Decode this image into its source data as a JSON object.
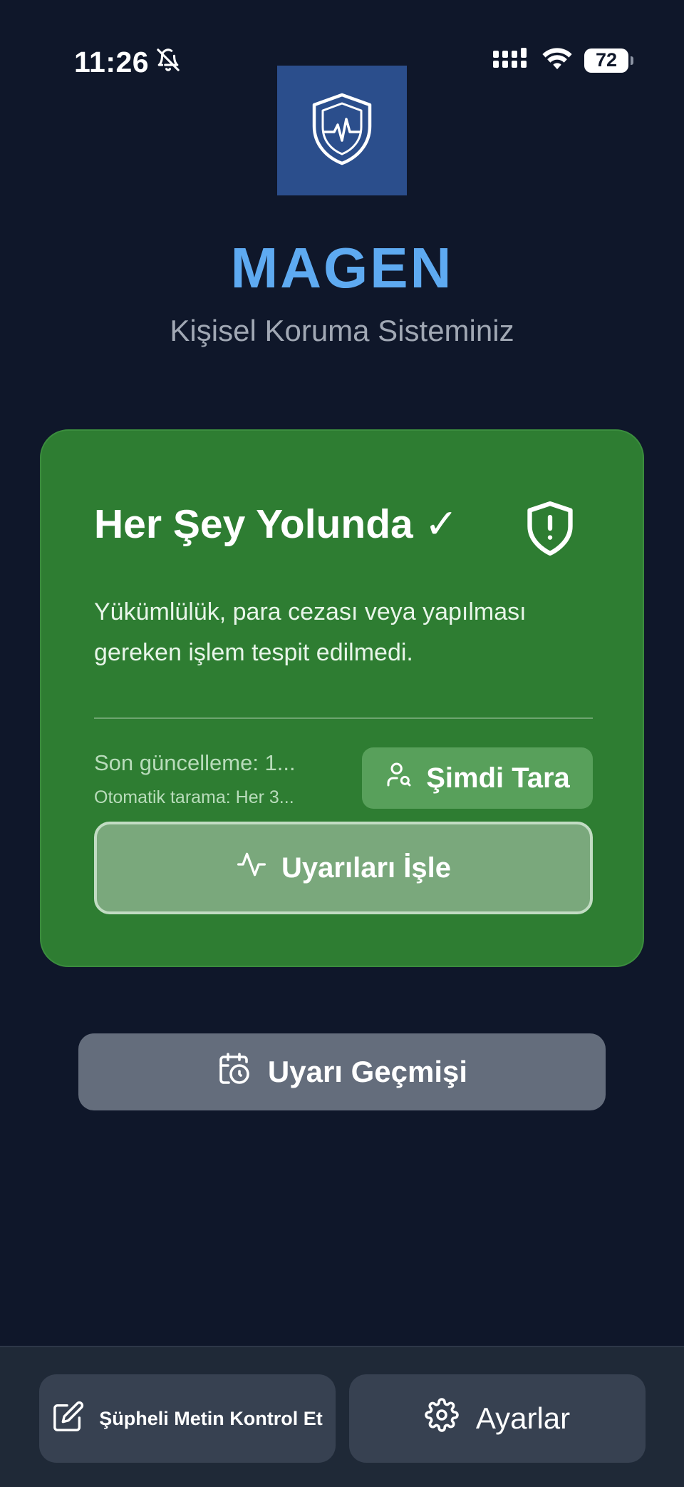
{
  "status_bar": {
    "time": "11:26",
    "battery": "72"
  },
  "app": {
    "title": "MAGEN",
    "subtitle": "Kişisel Koruma Sisteminiz",
    "logo_icon": "shield-heartbeat-icon"
  },
  "status_card": {
    "title": "Her Şey Yolunda ✓",
    "description": "Yükümlülük, para cezası veya yapılması gereken işlem tespit edilmedi.",
    "last_update": "Son güncelleme: 1...",
    "auto_scan": "Otomatik tarama: Her 3...",
    "scan_button": "Şimdi Tara",
    "process_button": "Uyarıları İşle",
    "background_color": "#2e7d32"
  },
  "history_button": "Uyarı Geçmişi",
  "bottom_bar": {
    "check_text_button": "Şüpheli Metin Kontrol Et",
    "settings_button": "Ayarlar"
  },
  "colors": {
    "background": "#0f172a",
    "accent": "#5eaaf1",
    "logo_bg": "#2b4e8c"
  }
}
